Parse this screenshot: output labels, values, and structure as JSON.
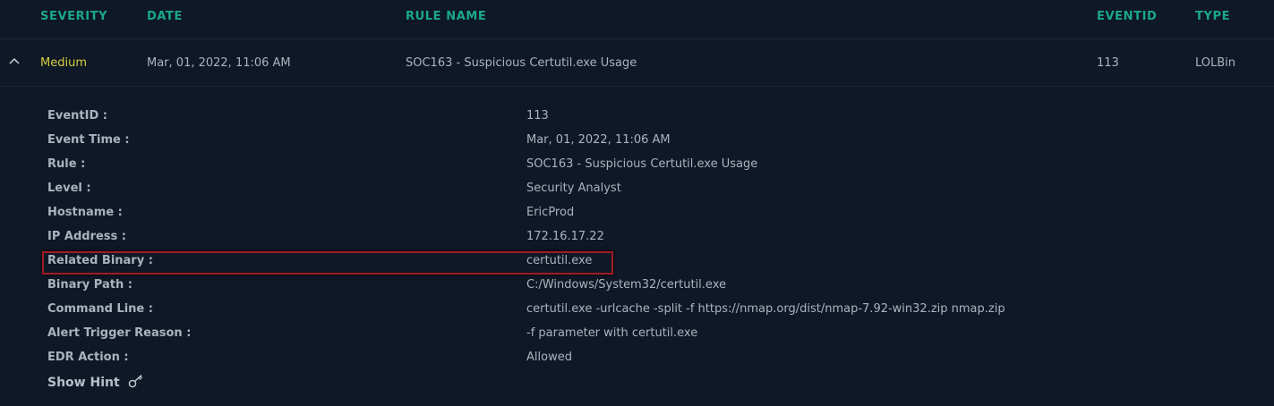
{
  "table": {
    "columns": {
      "severity": "SEVERITY",
      "date": "DATE",
      "rule_name": "RULE NAME",
      "eventid": "EVENTID",
      "type": "TYPE"
    },
    "row": {
      "severity": "Medium",
      "date": "Mar, 01, 2022, 11:06 AM",
      "rule_name": "SOC163 - Suspicious Certutil.exe Usage",
      "eventid": "113",
      "type": "LOLBin"
    }
  },
  "details": [
    {
      "label": "EventID :",
      "value": "113"
    },
    {
      "label": "Event Time :",
      "value": "Mar, 01, 2022, 11:06 AM"
    },
    {
      "label": "Rule :",
      "value": "SOC163 - Suspicious Certutil.exe Usage"
    },
    {
      "label": "Level :",
      "value": "Security Analyst"
    },
    {
      "label": "Hostname :",
      "value": "EricProd"
    },
    {
      "label": "IP Address :",
      "value": "172.16.17.22"
    },
    {
      "label": "Related Binary :",
      "value": "certutil.exe"
    },
    {
      "label": "Binary Path :",
      "value": "C:/Windows/System32/certutil.exe"
    },
    {
      "label": "Command Line :",
      "value": "certutil.exe -urlcache -split -f https://nmap.org/dist/nmap-7.92-win32.zip nmap.zip"
    },
    {
      "label": "Alert Trigger Reason :",
      "value": "-f parameter with certutil.exe"
    },
    {
      "label": "EDR Action :",
      "value": "Allowed"
    }
  ],
  "hint": {
    "label": "Show Hint",
    "icon": "key-icon"
  },
  "colors": {
    "background": "#0f1826",
    "header_accent": "#1aa78f",
    "severity_medium": "#d6cf3c",
    "highlight_border": "#a01c22"
  }
}
